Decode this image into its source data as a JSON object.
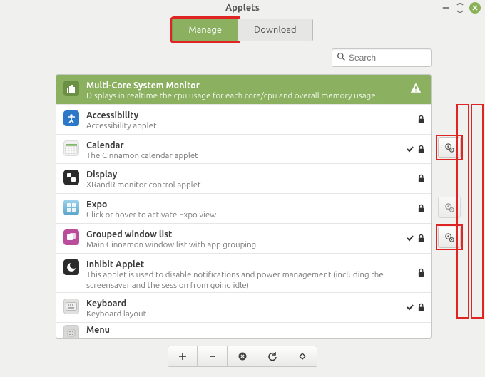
{
  "window": {
    "title": "Applets"
  },
  "tabs": {
    "manage": "Manage",
    "download": "Download"
  },
  "search": {
    "placeholder": "Search"
  },
  "applets": [
    {
      "title": "Multi-Core System Monitor",
      "desc": "Displays in realtime the cpu usage for each core/cpu and overall memory usage.",
      "selected": true,
      "warn": true,
      "lock": false,
      "check": false,
      "icon": "monitor"
    },
    {
      "title": "Accessibility",
      "desc": "Accessibility applet",
      "lock": true,
      "check": false,
      "icon": "access"
    },
    {
      "title": "Calendar",
      "desc": "The Cinnamon calendar applet",
      "lock": true,
      "check": true,
      "icon": "calendar"
    },
    {
      "title": "Display",
      "desc": "XRandR monitor control applet",
      "lock": true,
      "check": false,
      "icon": "display"
    },
    {
      "title": "Expo",
      "desc": "Click or hover to activate Expo view",
      "lock": true,
      "check": false,
      "icon": "expo"
    },
    {
      "title": "Grouped window list",
      "desc": "Main Cinnamon window list with app grouping",
      "lock": true,
      "check": true,
      "icon": "group"
    },
    {
      "title": "Inhibit Applet",
      "desc": "This applet is used to disable notifications and power management (including the screensaver and the session from going idle)",
      "lock": true,
      "check": false,
      "icon": "inhibit"
    },
    {
      "title": "Keyboard",
      "desc": "Keyboard layout",
      "lock": true,
      "check": true,
      "icon": "keyboard"
    },
    {
      "title": "Menu",
      "desc": "",
      "lock": false,
      "check": false,
      "icon": "menu",
      "cutoff": true
    }
  ],
  "gears": [
    {
      "enabled": true
    },
    {
      "enabled": false
    },
    {
      "enabled": true
    }
  ]
}
